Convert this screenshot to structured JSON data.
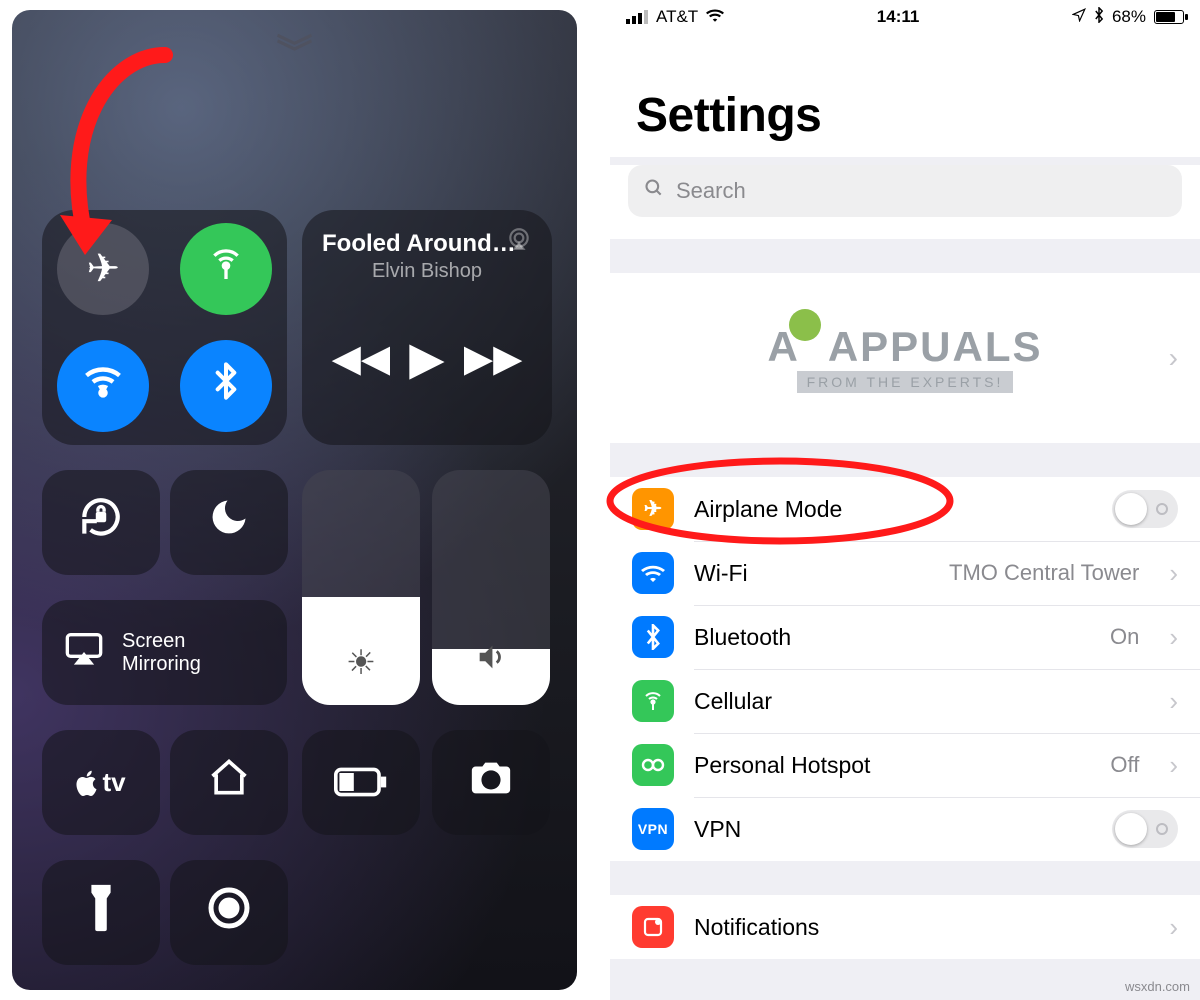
{
  "statusbar": {
    "carrier": "AT&T",
    "time": "14:11",
    "battery_pct": "68%"
  },
  "settings": {
    "title": "Settings",
    "search_placeholder": "Search",
    "rows": {
      "airplane": "Airplane Mode",
      "wifi": "Wi-Fi",
      "wifi_value": "TMO Central Tower",
      "bluetooth": "Bluetooth",
      "bluetooth_value": "On",
      "cellular": "Cellular",
      "hotspot": "Personal Hotspot",
      "hotspot_value": "Off",
      "vpn": "VPN",
      "notifications": "Notifications"
    },
    "vpn_badge": "VPN"
  },
  "watermark": {
    "line1": "APPUALS",
    "line2": "FROM THE EXPERTS!"
  },
  "control_center": {
    "music": {
      "title": "Fooled Around…",
      "artist": "Elvin Bishop"
    },
    "screen_mirroring": "Screen\nMirroring",
    "apple_tv": "tv"
  },
  "credit": "wsxdn.com"
}
